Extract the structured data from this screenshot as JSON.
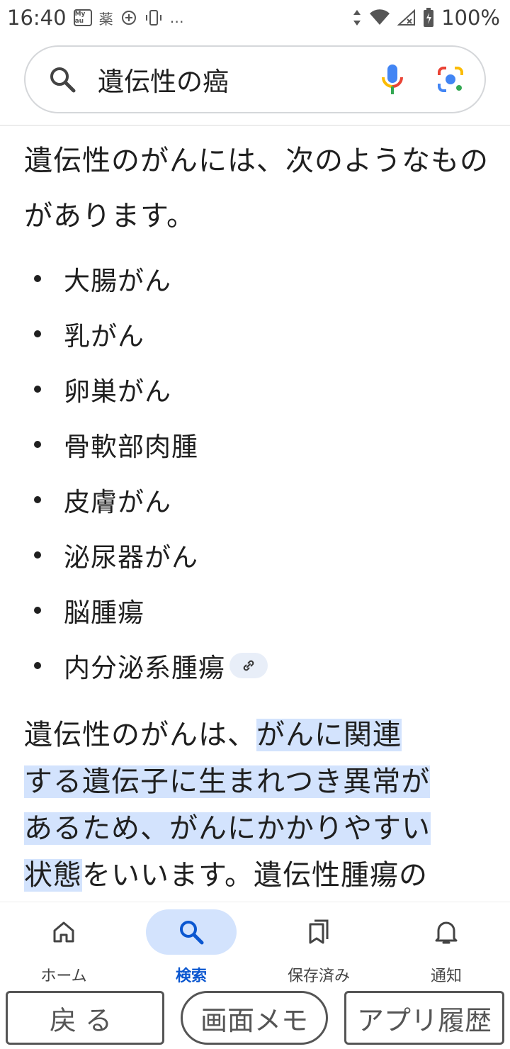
{
  "status_bar": {
    "time": "16:40",
    "badges": [
      "My au",
      "薬"
    ],
    "more": "…",
    "battery": "100%"
  },
  "search": {
    "query": "遺伝性の癌"
  },
  "content": {
    "intro": "遺伝性のがんには、次のようなものがあります。",
    "items": [
      "大腸がん",
      "乳がん",
      "卵巣がん",
      "骨軟部肉腫",
      "皮膚がん",
      "泌尿器がん",
      "脳腫瘍",
      "内分泌系腫瘍"
    ],
    "para_pre": "遺伝性のがんは、",
    "para_highlight_1": "がんに関連",
    "para_highlight_2": "する遺伝子に生まれつき異常が",
    "para_highlight_3": "あるため、がんにかかりやすい",
    "para_highlight_4": "状態",
    "para_post": "をいいます。遺伝性腫瘍の"
  },
  "bottom_nav": {
    "home": "ホーム",
    "search": "検索",
    "saved": "保存済み",
    "notifications": "通知"
  },
  "system": {
    "back": "戻る",
    "memo": "画面メモ",
    "history": "アプリ履歴"
  },
  "colors": {
    "highlight": "#d3e3fd",
    "active_blue": "#0b57d0"
  }
}
